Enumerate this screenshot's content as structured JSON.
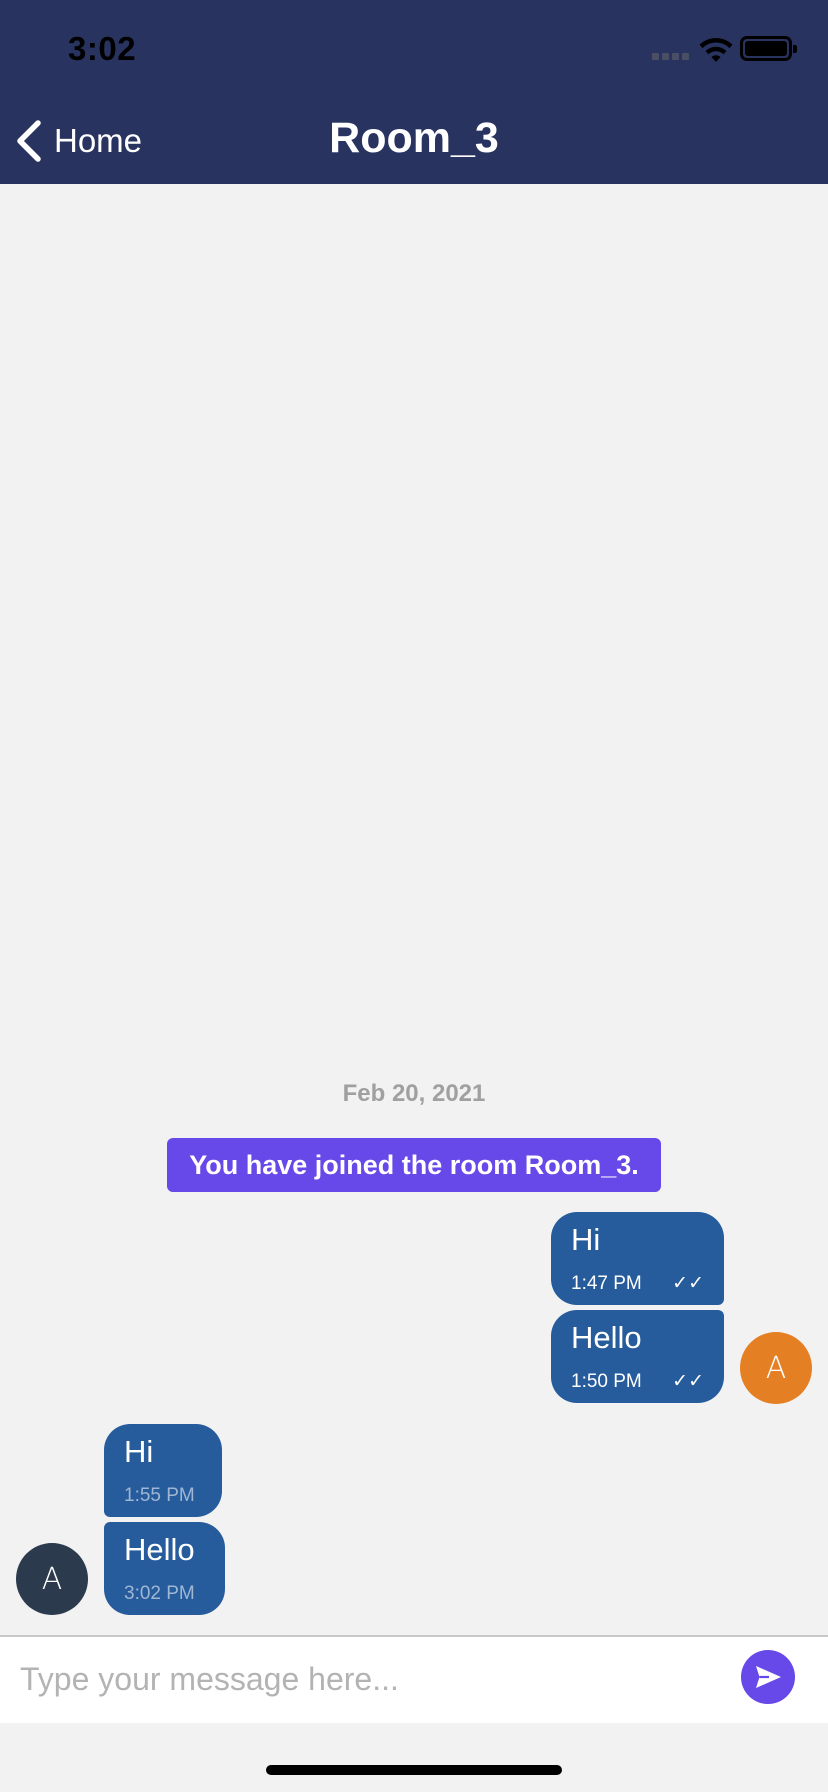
{
  "status_bar": {
    "time": "3:02"
  },
  "nav": {
    "back_label": "Home",
    "title": "Room_3"
  },
  "chat": {
    "date_separator": "Feb 20, 2021",
    "system_message": "You have joined the room Room_3.",
    "messages": [
      {
        "text": "Hi",
        "time": "1:47 PM",
        "ticks": "✓✓",
        "direction": "outgoing"
      },
      {
        "text": "Hello",
        "time": "1:50 PM",
        "ticks": "✓✓",
        "direction": "outgoing"
      },
      {
        "text": "Hi",
        "time": "1:55 PM",
        "direction": "incoming"
      },
      {
        "text": "Hello",
        "time": "3:02 PM",
        "direction": "incoming"
      }
    ],
    "avatar_outgoing": {
      "initial": "A",
      "color": "#e57f24"
    },
    "avatar_incoming": {
      "initial": "A",
      "color": "#2b3a4c"
    }
  },
  "composer": {
    "placeholder": "Type your message here...",
    "value": ""
  },
  "colors": {
    "header": "#283360",
    "bubble": "#275c9c",
    "accent": "#6748e8"
  }
}
